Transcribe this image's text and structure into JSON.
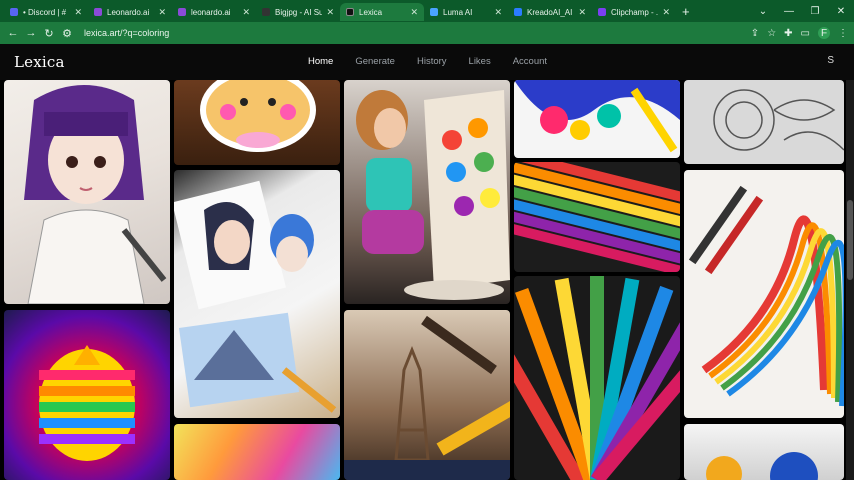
{
  "browser": {
    "tabs": [
      {
        "label": "• Discord | #",
        "color": "#5865f2"
      },
      {
        "label": "Leonardo.ai",
        "color": "#8a4bd8"
      },
      {
        "label": "leonardo.ai",
        "color": "#8a4bd8"
      },
      {
        "label": "Bigjpg - AI Su",
        "color": "#333333"
      },
      {
        "label": "Lexica",
        "color": "#111111",
        "active": true
      },
      {
        "label": "Luma AI",
        "color": "#4aa3ff"
      },
      {
        "label": "KreadoAI_AI",
        "color": "#2b7cff"
      },
      {
        "label": "Clipchamp - ...",
        "color": "#7b3ff2"
      }
    ],
    "url": "lexica.art/?q=coloring",
    "profile_initial": "F"
  },
  "site": {
    "logo": "Lexica",
    "nav": [
      {
        "label": "Home",
        "active": true
      },
      {
        "label": "Generate"
      },
      {
        "label": "History"
      },
      {
        "label": "Likes"
      },
      {
        "label": "Account"
      }
    ],
    "search_icon": "S"
  },
  "grid": {
    "images": [
      {
        "id": "girl-portrait-sketch"
      },
      {
        "id": "hamster-sticker"
      },
      {
        "id": "child-painting"
      },
      {
        "id": "paint-splash"
      },
      {
        "id": "mandala-lineart"
      },
      {
        "id": "anime-sketches"
      },
      {
        "id": "pencil-rows"
      },
      {
        "id": "rainbow-swirl"
      },
      {
        "id": "rainbow-sphere"
      },
      {
        "id": "eiffel-pencils"
      },
      {
        "id": "pencil-fan"
      },
      {
        "id": "bottom-strip-2"
      },
      {
        "id": "bottom-strip-5"
      }
    ]
  }
}
